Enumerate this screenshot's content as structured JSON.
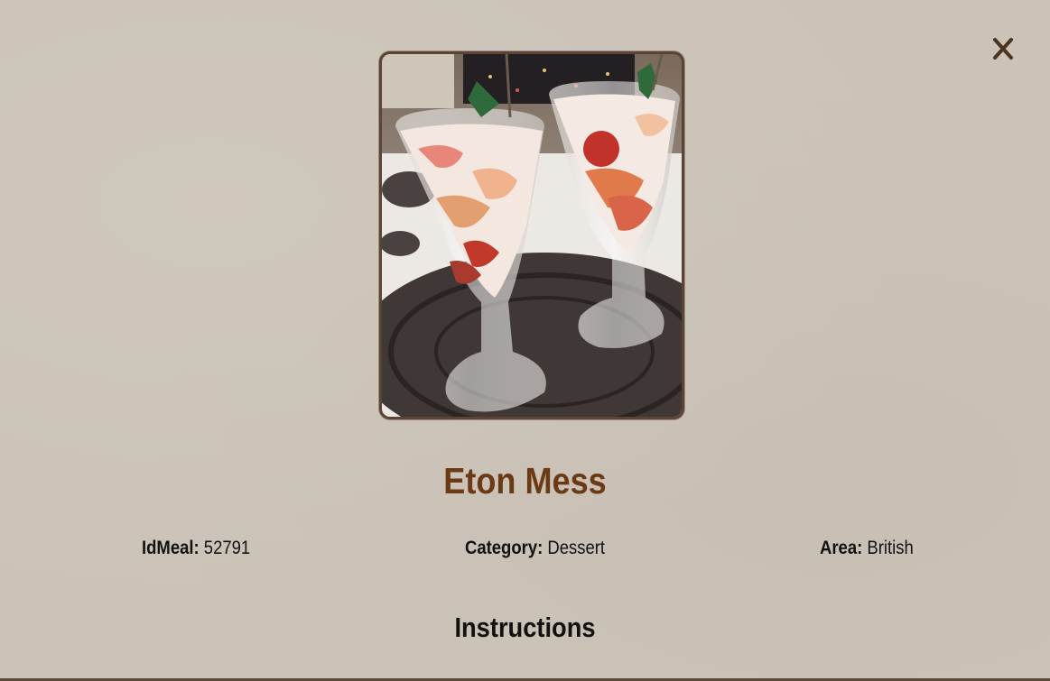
{
  "meal": {
    "title": "Eton Mess",
    "id_label": "IdMeal:",
    "id_value": "52791",
    "category_label": "Category:",
    "category_value": "Dessert",
    "area_label": "Area:",
    "area_value": "British"
  },
  "sections": {
    "instructions_heading": "Instructions"
  },
  "controls": {
    "close_icon": "close-icon"
  },
  "colors": {
    "background": "#cbc3b7",
    "title": "#6b3a14",
    "frame_border": "#5a4436",
    "close_icon": "#4a3320"
  }
}
